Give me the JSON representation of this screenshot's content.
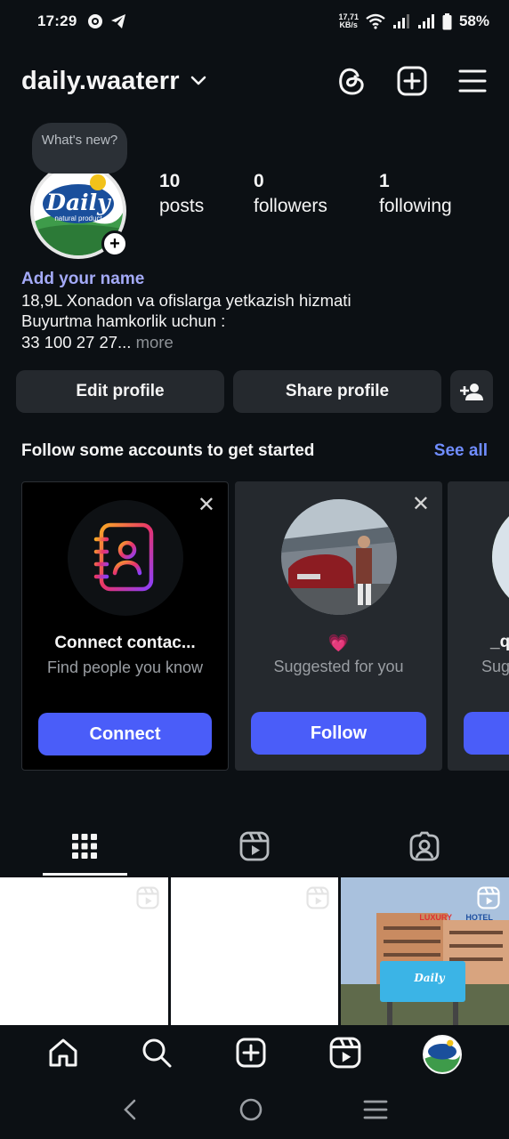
{
  "status": {
    "time": "17:29",
    "net_speed_value": "17,71",
    "net_speed_unit": "KB/s",
    "battery": "58%",
    "icons": [
      "sync-icon",
      "telegram-icon",
      "wifi-icon",
      "signal-icon",
      "signal-icon",
      "battery-icon"
    ]
  },
  "header": {
    "username": "daily.waaterr",
    "icons": [
      "chevron-down-icon",
      "threads-icon",
      "new-post-icon",
      "menu-icon"
    ]
  },
  "profile": {
    "note_bubble": "What's new?",
    "avatar_logo": "Daily",
    "avatar_tagline": "natural product",
    "stats": [
      {
        "value": "10",
        "label": "posts"
      },
      {
        "value": "0",
        "label": "followers"
      },
      {
        "value": "1",
        "label": "following"
      }
    ],
    "add_name": "Add your name",
    "bio_lines": [
      "18,9L Xonadon va ofislarga yetkazish hizmati",
      "Buyurtma hamkorlik uchun :",
      "33 100 27 27..."
    ],
    "bio_more": " more"
  },
  "actions": {
    "edit": "Edit profile",
    "share": "Share profile"
  },
  "suggestions": {
    "title": "Follow some accounts to get started",
    "see_all": "See all",
    "cards": [
      {
        "name": "Connect contac...",
        "subtitle": "Find people you know",
        "cta": "Connect"
      },
      {
        "name": "💗",
        "subtitle": "Suggested for you",
        "cta": "Follow"
      },
      {
        "name": "_q",
        "subtitle": "Sug",
        "cta": ""
      }
    ]
  },
  "tabs": [
    "grid-icon",
    "reels-icon",
    "tagged-icon"
  ],
  "grid_overlay": {
    "billboard": "Daily",
    "sign_left": "LUXURY",
    "sign_right": "HOTEL"
  },
  "bottom_nav": [
    "home-icon",
    "search-icon",
    "create-icon",
    "reels-icon",
    "profile-avatar"
  ],
  "system_nav": [
    "back-icon",
    "home-circle-icon",
    "recents-icon"
  ],
  "colors": {
    "background": "#0c1014",
    "accent": "#4a5df9",
    "link": "#708dff",
    "add_name": "#a4aaf8",
    "button": "#25292e"
  }
}
